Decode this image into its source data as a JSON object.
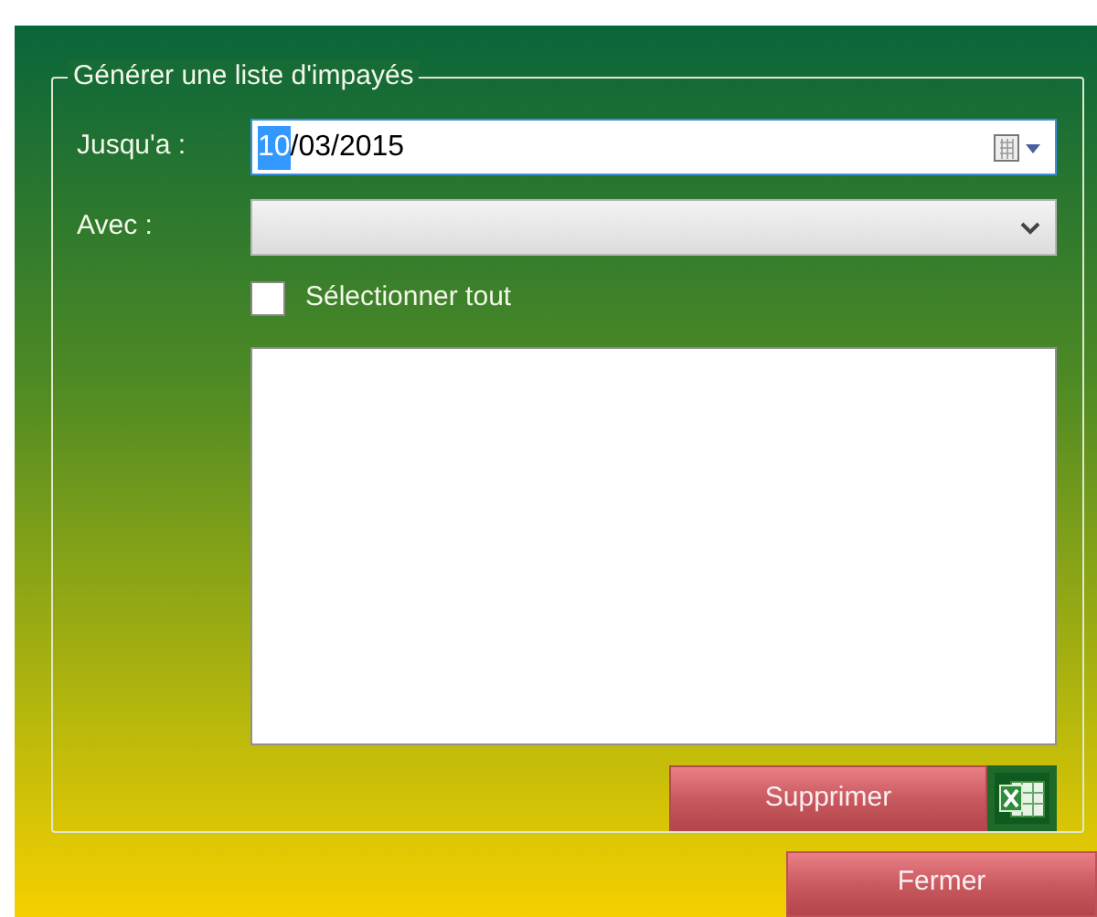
{
  "group": {
    "legend": "Générer une liste d'impayés"
  },
  "date_field": {
    "label": "Jusqu'a :",
    "parts": [
      {
        "text": "10",
        "selected": true
      },
      {
        "text": "/03/2015",
        "selected": false
      }
    ]
  },
  "combo": {
    "label": "Avec :",
    "disabled": true
  },
  "select_all": {
    "label": "Sélectionner tout",
    "checked": false
  },
  "buttons": [
    {
      "label": "Supprimer",
      "kind": "excel"
    },
    {
      "label": "Fermer",
      "kind": "plain"
    }
  ]
}
